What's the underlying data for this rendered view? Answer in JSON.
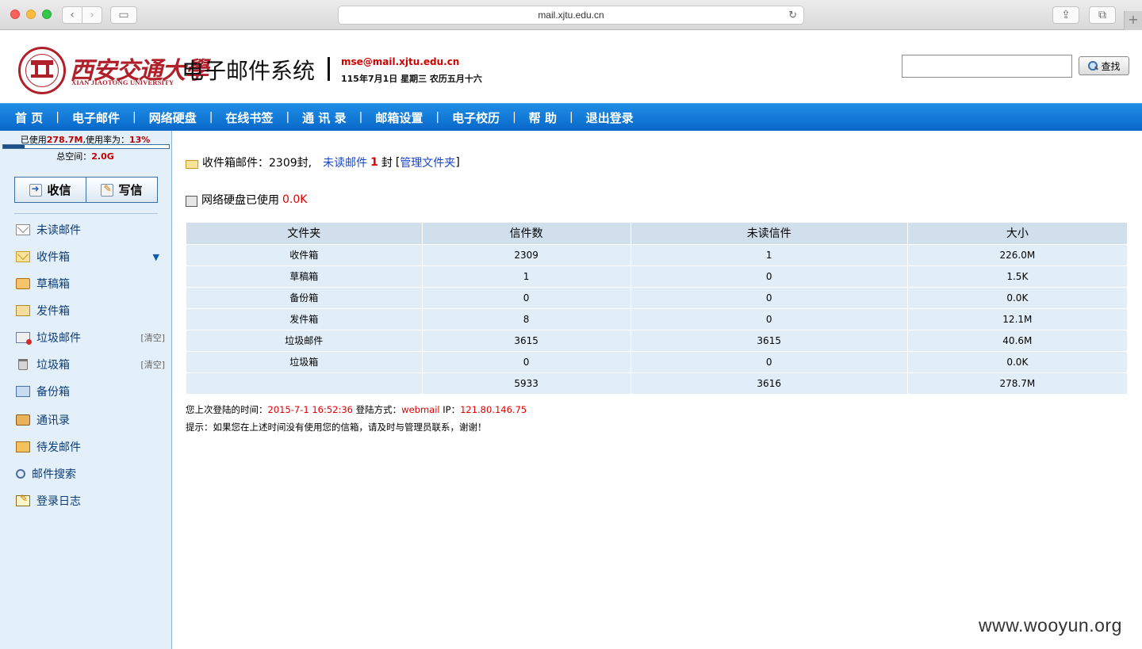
{
  "browser": {
    "url": "mail.xjtu.edu.cn",
    "back_icon": "‹",
    "forward_icon": "›",
    "sidebar_icon": "▭",
    "share_icon": "⇪",
    "tabs_icon": "⧉",
    "reload_icon": "↻",
    "newtab_icon": "+"
  },
  "header": {
    "logo_cn": "西安交通大學",
    "logo_en": "XIAN JIAOTONG UNIVERSITY",
    "system_title": "电子邮件系统",
    "user_email": "mse@mail.xjtu.edu.cn",
    "date_line": "115年7月1日 星期三 农历五月十六",
    "search_placeholder": "",
    "search_button": "查找",
    "brand_color": "#b0202a"
  },
  "nav": {
    "items": [
      "首 页",
      "电子邮件",
      "网络硬盘",
      "在线书签",
      "通 讯 录",
      "邮箱设置",
      "电子校历",
      "帮 助",
      "退出登录"
    ],
    "separator": "|",
    "bg_color": "#0b74d6"
  },
  "sidebar": {
    "usage_prefix": "已使用",
    "usage_value": "278.7M",
    "usage_mid": ",使用率为：",
    "usage_percent": "13%",
    "usage_fraction": 0.13,
    "total_prefix": "总空间：",
    "total_value": "2.0G",
    "receive_button": "收信",
    "write_button": "写信",
    "items": [
      {
        "label": "未读邮件",
        "icon": "envelope-icon"
      },
      {
        "label": "收件箱",
        "icon": "inbox-icon",
        "arrow": "▼"
      },
      {
        "label": "草稿箱",
        "icon": "draft-icon"
      },
      {
        "label": "发件箱",
        "icon": "sent-icon"
      },
      {
        "label": "垃圾邮件",
        "icon": "junk-icon",
        "extra": "[清空]"
      },
      {
        "label": "垃圾箱",
        "icon": "trash-icon",
        "extra": "[清空]"
      },
      {
        "label": "备份箱",
        "icon": "backup-icon"
      },
      {
        "label": "通讯录",
        "icon": "contacts-icon"
      },
      {
        "label": "待发邮件",
        "icon": "pending-icon"
      },
      {
        "label": "邮件搜索",
        "icon": "search-icon"
      },
      {
        "label": "登录日志",
        "icon": "log-icon"
      }
    ]
  },
  "main": {
    "inbox_prefix": "收件箱邮件：",
    "inbox_count": "2309封,",
    "unread_label": "未读邮件",
    "unread_count": "1",
    "unread_unit": "封",
    "manage_open": "[",
    "manage_link": "管理文件夹",
    "manage_close": "]",
    "disk_prefix": "网络硬盘已使用",
    "disk_value": "0.0K",
    "table": {
      "headers": [
        "文件夹",
        "信件数",
        "未读信件",
        "大小"
      ],
      "rows": [
        [
          "收件箱",
          "2309",
          "1",
          "226.0M"
        ],
        [
          "草稿箱",
          "1",
          "0",
          "1.5K"
        ],
        [
          "备份箱",
          "0",
          "0",
          "0.0K"
        ],
        [
          "发件箱",
          "8",
          "0",
          "12.1M"
        ],
        [
          "垃圾邮件",
          "3615",
          "3615",
          "40.6M"
        ],
        [
          "垃圾箱",
          "0",
          "0",
          "0.0K"
        ],
        [
          "",
          "5933",
          "3616",
          "278.7M"
        ]
      ]
    },
    "login_prefix": "您上次登陆的时间：",
    "login_time": "2015-7-1 16:52:36",
    "login_method_label": "登陆方式：",
    "login_method": "webmail",
    "ip_label": "IP：",
    "ip": "121.80.146.75",
    "tip": "提示：如果您在上述时间没有使用您的信箱，请及时与管理员联系，谢谢！"
  },
  "watermark": "www.wooyun.org"
}
